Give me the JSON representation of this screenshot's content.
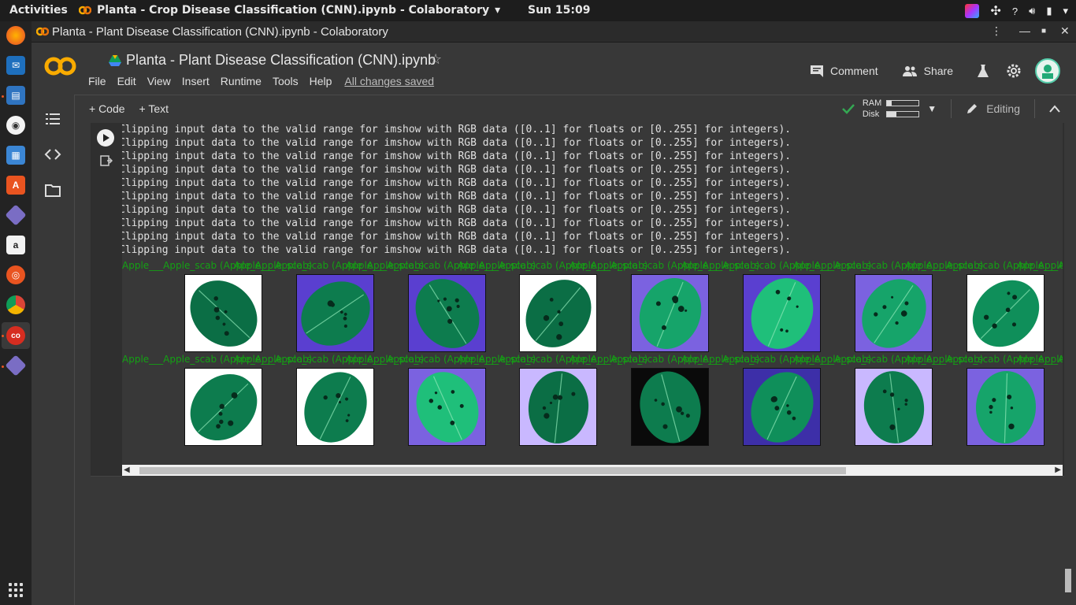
{
  "system_bar": {
    "activities": "Activities",
    "app_title": "Planta - Crop Disease Classification (CNN).ipynb - Colaboratory",
    "clock": "Sun 15:09"
  },
  "window": {
    "title": "Planta - Plant Disease Classification (CNN).ipynb - Colaboratory"
  },
  "colab": {
    "logo_text": "CO",
    "notebook_title": "Planta - Plant Disease Classification (CNN).ipynb",
    "menu": [
      "File",
      "Edit",
      "View",
      "Insert",
      "Runtime",
      "Tools",
      "Help"
    ],
    "save_status": "All changes saved",
    "comment_label": "Comment",
    "share_label": "Share"
  },
  "toolbar": {
    "add_code": "+ Code",
    "add_text": "+ Text",
    "ram_label": "RAM",
    "disk_label": "Disk",
    "ram_usage": 0.15,
    "disk_usage": 0.3,
    "editing_label": "Editing"
  },
  "output": {
    "log_line": "Clipping input data to the valid range for imshow with RGB data ([0..1] for floats or [0..255] for integers).",
    "log_count": 10,
    "first_label": "Apple___Apple_scab",
    "repeat_label": "Apple___Apple_scab (Apple_Apple_scab)"
  },
  "colors": {
    "accent": "#f9ab00",
    "label_green": "#14a014",
    "ubuntu_orange": "#e95420"
  }
}
